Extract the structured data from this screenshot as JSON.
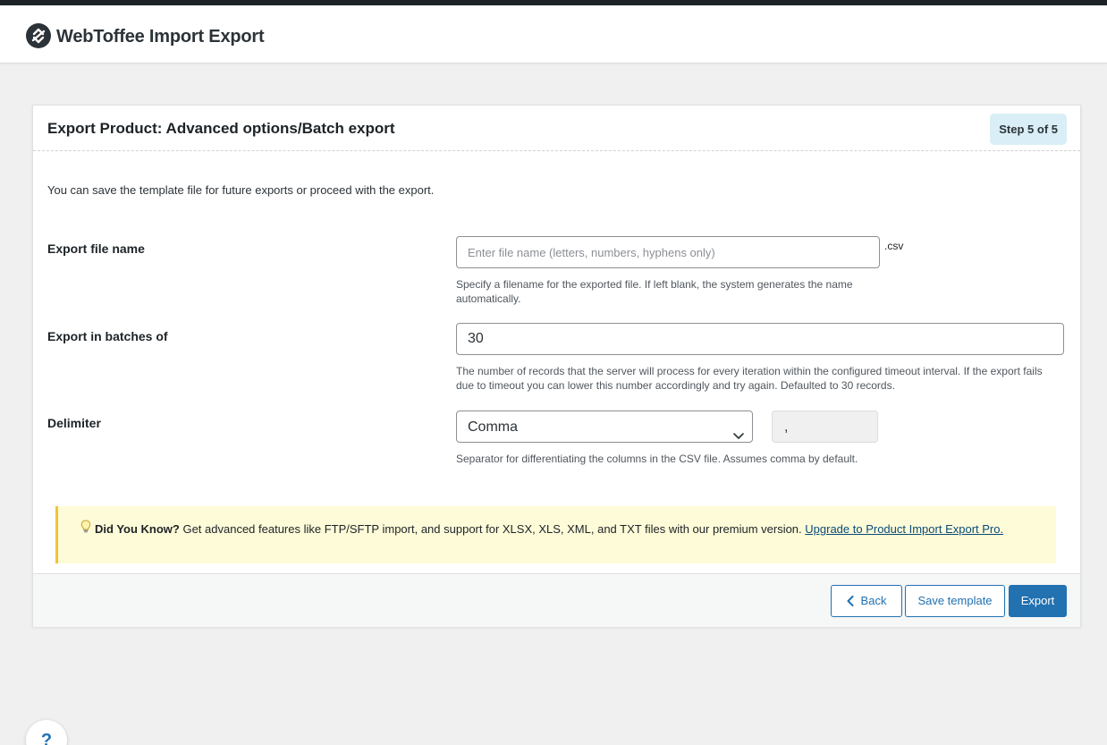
{
  "header": {
    "brand": "WebToffee Import Export",
    "logo_icon": "arrows-circle-logo-icon"
  },
  "card": {
    "title": "Export Product: Advanced options/Batch export",
    "step_badge": "Step 5 of 5",
    "intro": "You can save the template file for future exports or proceed with the export."
  },
  "fields": {
    "filename": {
      "label": "Export file name",
      "value": "",
      "placeholder": "Enter file name (letters, numbers, hyphens only)",
      "extension": ".csv",
      "help": "Specify a filename for the exported file. If left blank, the system generates the name automatically."
    },
    "batch": {
      "label": "Export in batches of",
      "value": "30",
      "help": "The number of records that the server will process for every iteration within the configured timeout interval. If the export fails due to timeout you can lower this number accordingly and try again. Defaulted to 30 records."
    },
    "delimiter": {
      "label": "Delimiter",
      "selected": "Comma",
      "character": ",",
      "help": "Separator for differentiating the columns in the CSV file. Assumes comma by default."
    }
  },
  "notice": {
    "icon": "lightbulb-icon",
    "bold": "Did You Know?",
    "text": " Get advanced features like FTP/SFTP import, and support for XLSX, XLS, XML, and TXT files with our premium version. ",
    "link": "Upgrade to Product Import Export Pro."
  },
  "footer": {
    "back_label": "Back",
    "save_label": "Save template",
    "export_label": "Export"
  },
  "help_bubble": {
    "label": "?"
  },
  "colors": {
    "primary": "#2271b1",
    "notice_bg": "#fefbd8",
    "notice_border": "#f0c33c",
    "badge_bg": "#d9eef6"
  }
}
